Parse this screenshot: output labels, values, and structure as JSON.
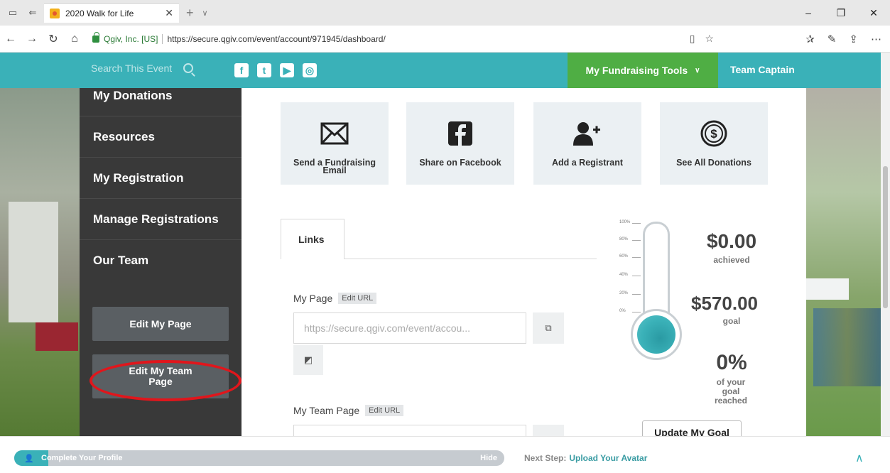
{
  "browser": {
    "tab_title": "2020 Walk for Life",
    "site_identity": "Qgiv, Inc. [US]",
    "url": "https://secure.qgiv.com/event/account/971945/dashboard/",
    "url_bold": "secure.qgiv.com",
    "icons": [
      "tab-actions-icon",
      "tab-list-icon",
      "back-icon",
      "forward-icon",
      "refresh-icon",
      "home-icon",
      "reading-view-icon",
      "favorite-star-icon",
      "favorites-icon",
      "pen-icon",
      "share-icon",
      "more-icon"
    ]
  },
  "header": {
    "search_placeholder": "Search This Event",
    "fundraising_tools": "My Fundraising Tools",
    "team_captain": "Team Captain",
    "accent_color": "#3ab1b8",
    "tools_color": "#4fae44"
  },
  "sidebar": {
    "items": [
      {
        "label": "My Donations"
      },
      {
        "label": "Resources"
      },
      {
        "label": "My Registration"
      },
      {
        "label": "Manage Registrations"
      },
      {
        "label": "Our Team"
      }
    ],
    "buttons": {
      "edit_page": "Edit My Page",
      "edit_team_page": "Edit My Team Page"
    }
  },
  "cards": [
    {
      "label": "Send a Fundraising Email",
      "icon": "envelope-icon"
    },
    {
      "label": "Share on Facebook",
      "icon": "facebook-icon"
    },
    {
      "label": "Add a Registrant",
      "icon": "add-user-icon"
    },
    {
      "label": "See All Donations",
      "icon": "dollar-circle-icon"
    }
  ],
  "links": {
    "tab_label": "Links",
    "my_page_label": "My Page",
    "edit_url": "Edit URL",
    "my_page_url": "https://secure.qgiv.com/event/accou...",
    "my_team_page_label": "My Team Page"
  },
  "goal": {
    "achieved_amount": "$0.00",
    "achieved_label": "achieved",
    "goal_amount": "$570.00",
    "goal_label": "goal",
    "percent": "0%",
    "percent_label": "of your goal reached",
    "scale": [
      "100%",
      "80%",
      "60%",
      "40%",
      "20%",
      "0%"
    ],
    "update_button": "Update My Goal"
  },
  "bottom": {
    "profile_text": "Complete Your Profile",
    "hide": "Hide",
    "next_step_label": "Next Step:",
    "next_step_link": "Upload Your Avatar",
    "profile_progress": 0.07
  }
}
